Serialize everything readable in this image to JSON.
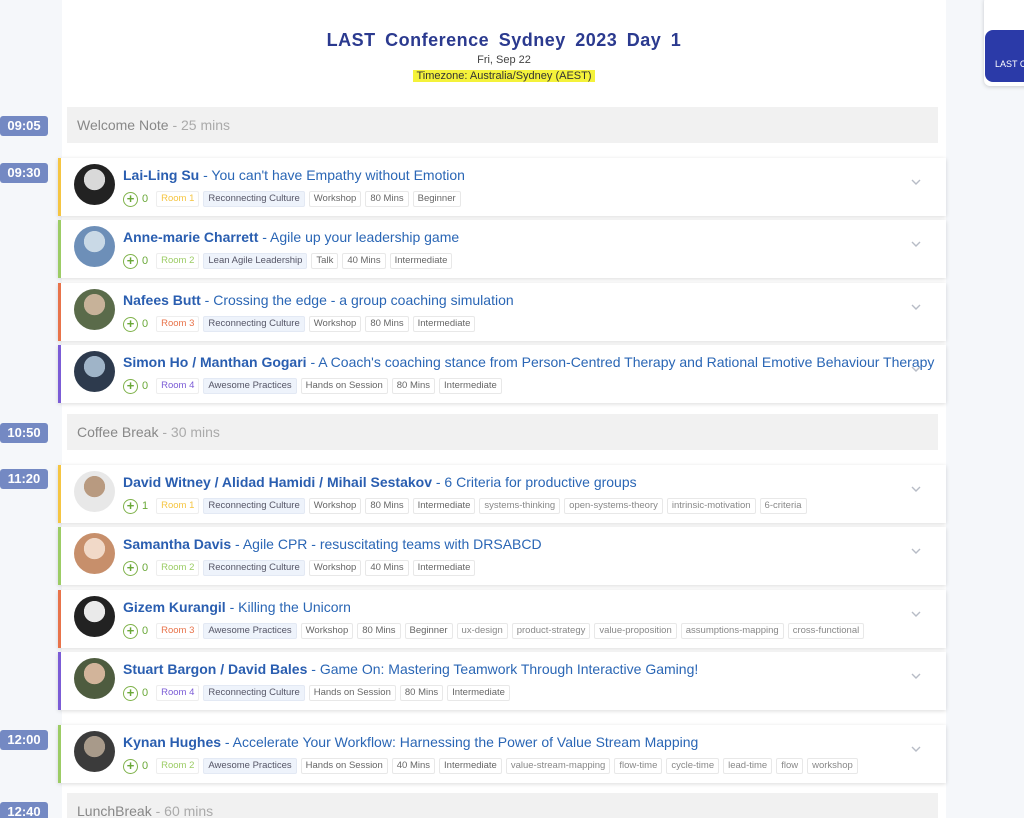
{
  "header": {
    "title": "LAST Conference Sydney 2023 Day 1",
    "date": "Fri, Sep 22",
    "timezone": "Timezone: Australia/Sydney (AEST)"
  },
  "side_button": {
    "label": "LAST C"
  },
  "colors": {
    "room1": "#f5c542",
    "room2": "#9ccc65",
    "room3": "#e8734a",
    "room4": "#7b5cd6",
    "time_badge": "#7489c3"
  },
  "times": [
    "09:05",
    "09:30",
    "10:50",
    "11:20",
    "12:00",
    "12:40"
  ],
  "breaks": [
    {
      "name": "Welcome Note",
      "duration": " - 25 mins"
    },
    {
      "name": "Coffee Break",
      "duration": " - 30 mins"
    },
    {
      "name": "LunchBreak",
      "duration": " - 60 mins"
    }
  ],
  "sessions": [
    {
      "speaker": "Lai-Ling Su",
      "title": " - You can't have Empathy without Emotion",
      "count": "0",
      "room": "Room 1",
      "track": "Reconnecting Culture",
      "format": "Workshop",
      "length": "80 Mins",
      "level": "Beginner",
      "keywords": []
    },
    {
      "speaker": "Anne-marie Charrett",
      "title": " - Agile up your leadership game",
      "count": "0",
      "room": "Room 2",
      "track": "Lean Agile Leadership",
      "format": "Talk",
      "length": "40 Mins",
      "level": "Intermediate",
      "keywords": []
    },
    {
      "speaker": "Nafees Butt",
      "title": " - Crossing the edge - a group coaching simulation",
      "count": "0",
      "room": "Room 3",
      "track": "Reconnecting Culture",
      "format": "Workshop",
      "length": "80 Mins",
      "level": "Intermediate",
      "keywords": []
    },
    {
      "speaker": "Simon Ho / Manthan Gogari",
      "title": " - A Coach's coaching stance from Person-Centred Therapy and Rational Emotive Behaviour Therapy",
      "count": "0",
      "room": "Room 4",
      "track": "Awesome Practices",
      "format": "Hands on Session",
      "length": "80 Mins",
      "level": "Intermediate",
      "keywords": []
    },
    {
      "speaker": "David Witney / Alidad Hamidi / Mihail Sestakov",
      "title": " - 6 Criteria for productive groups",
      "count": "1",
      "room": "Room 1",
      "track": "Reconnecting Culture",
      "format": "Workshop",
      "length": "80 Mins",
      "level": "Intermediate",
      "keywords": [
        "systems-thinking",
        "open-systems-theory",
        "intrinsic-motivation",
        "6-criteria"
      ]
    },
    {
      "speaker": "Samantha Davis",
      "title": " - Agile CPR - resuscitating teams with DRSABCD",
      "count": "0",
      "room": "Room 2",
      "track": "Reconnecting Culture",
      "format": "Workshop",
      "length": "40 Mins",
      "level": "Intermediate",
      "keywords": []
    },
    {
      "speaker": "Gizem Kurangil",
      "title": " - Killing the Unicorn",
      "count": "0",
      "room": "Room 3",
      "track": "Awesome Practices",
      "format": "Workshop",
      "length": "80 Mins",
      "level": "Beginner",
      "keywords": [
        "ux-design",
        "product-strategy",
        "value-proposition",
        "assumptions-mapping",
        "cross-functional"
      ]
    },
    {
      "speaker": "Stuart Bargon / David Bales",
      "title": " - Game On: Mastering Teamwork Through Interactive Gaming!",
      "count": "0",
      "room": "Room 4",
      "track": "Reconnecting Culture",
      "format": "Hands on Session",
      "length": "80 Mins",
      "level": "Intermediate",
      "keywords": []
    },
    {
      "speaker": "Kynan Hughes",
      "title": " - Accelerate Your Workflow: Harnessing the Power of Value Stream Mapping",
      "count": "0",
      "room": "Room 2",
      "track": "Awesome Practices",
      "format": "Hands on Session",
      "length": "40 Mins",
      "level": "Intermediate",
      "keywords": [
        "value-stream-mapping",
        "flow-time",
        "cycle-time",
        "lead-time",
        "flow",
        "workshop"
      ]
    }
  ]
}
